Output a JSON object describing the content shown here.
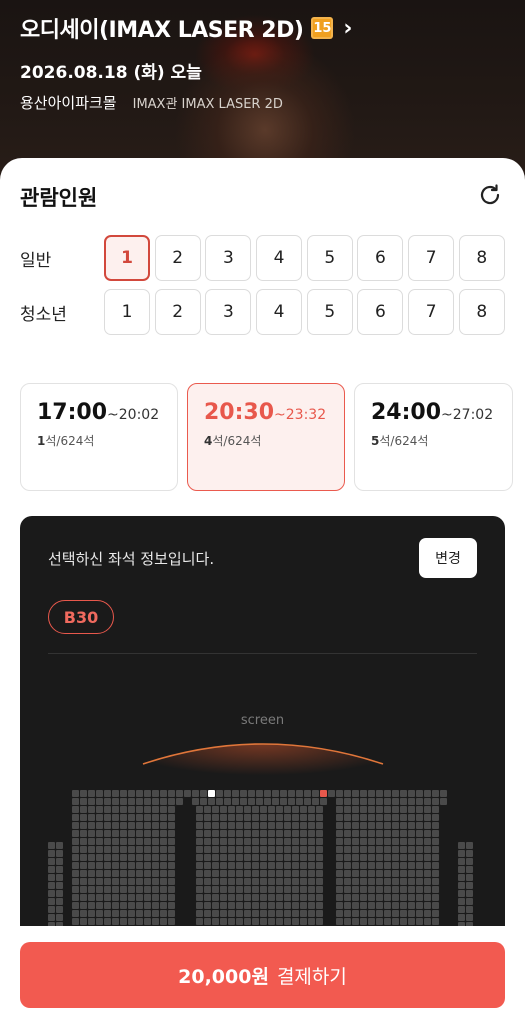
{
  "header": {
    "title": "오디세이(IMAX LASER 2D)",
    "age_rating": "15",
    "date": "2026.08.18 (화) 오늘",
    "theater": "용산아이파크몰",
    "hall": "IMAX관 IMAX LASER 2D"
  },
  "audience": {
    "title": "관람인원",
    "rows": [
      {
        "label": "일반",
        "options": [
          "1",
          "2",
          "3",
          "4",
          "5",
          "6",
          "7",
          "8"
        ],
        "selected": "1"
      },
      {
        "label": "청소년",
        "options": [
          "1",
          "2",
          "3",
          "4",
          "5",
          "6",
          "7",
          "8"
        ],
        "selected": null
      }
    ]
  },
  "showtimes": [
    {
      "start": "17:00",
      "end": "~20:02",
      "seats_left": "1",
      "seats_total": "석/624석",
      "selected": false
    },
    {
      "start": "20:30",
      "end": "~23:32",
      "seats_left": "4",
      "seats_total": "석/624석",
      "selected": true
    },
    {
      "start": "24:00",
      "end": "~27:02",
      "seats_left": "5",
      "seats_total": "석/624석",
      "selected": false
    }
  ],
  "seat_info": {
    "message": "선택하신 좌석 정보입니다.",
    "change_label": "변경",
    "selected_seat": "B30",
    "screen_label": "screen"
  },
  "payment": {
    "amount": "20,000원",
    "action": "결제하기"
  },
  "colors": {
    "accent": "#f25a50",
    "accent_dark": "#d2483c",
    "seat_box_bg": "#1a1a1a"
  }
}
